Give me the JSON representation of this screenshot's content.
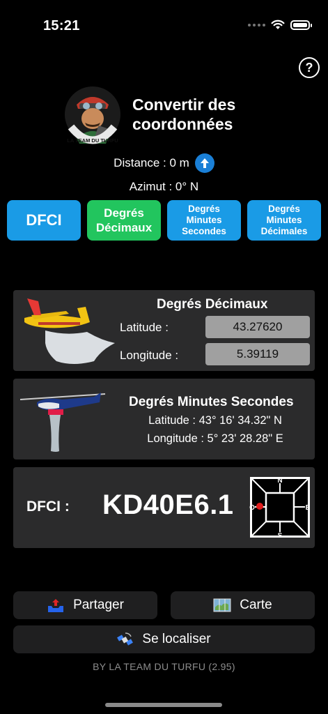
{
  "status_bar": {
    "time": "15:21"
  },
  "header": {
    "help_label": "?",
    "title_line1": "Convertir des",
    "title_line2": "coordonnées",
    "logo_text": "LA TEAM DU TURFU"
  },
  "info": {
    "distance": "Distance : 0 m",
    "azimut": "Azimut : 0° N"
  },
  "modes": [
    {
      "label": "DFCI",
      "active": false
    },
    {
      "label_line1": "Degrés",
      "label_line2": "Décimaux",
      "active": true
    },
    {
      "label_line1": "Degrés",
      "label_line2": "Minutes",
      "label_line3": "Secondes",
      "active": false
    },
    {
      "label_line1": "Degrés",
      "label_line2": "Minutes",
      "label_line3": "Décimales",
      "active": false
    }
  ],
  "decimal_card": {
    "title": "Degrés Décimaux",
    "latitude_label": "Latitude :",
    "latitude_value": "43.27620",
    "longitude_label": "Longitude :",
    "longitude_value": "5.39119"
  },
  "dms_card": {
    "title": "Degrés Minutes Secondes",
    "latitude": "Latitude : 43° 16' 34.32\" N",
    "longitude": "Longitude : 5° 23' 28.28\" E"
  },
  "dfci_card": {
    "label": "DFCI :",
    "code": "KD40E6.1",
    "compass": {
      "n": "N",
      "s": "S",
      "e": "E",
      "o": "O",
      "marker_color": "#e11d1d"
    }
  },
  "actions": {
    "share_label": "Partager",
    "map_label": "Carte",
    "locate_label": "Se localiser"
  },
  "footer": "BY LA TEAM DU TURFU (2.95)",
  "colors": {
    "accent_blue": "#1a9be6",
    "active_green": "#22c55e",
    "card_bg": "#2b2b2c"
  }
}
